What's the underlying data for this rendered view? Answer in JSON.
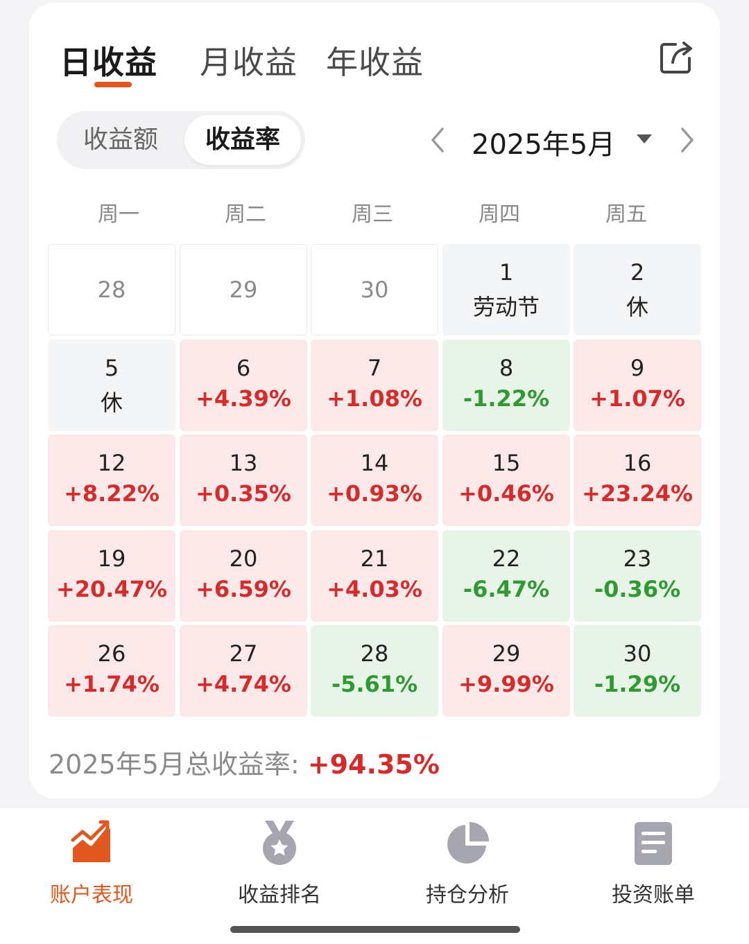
{
  "tabs": [
    {
      "label": "日收益",
      "active": true
    },
    {
      "label": "月收益",
      "active": false
    },
    {
      "label": "年收益",
      "active": false
    }
  ],
  "toggle": {
    "options": [
      "收益额",
      "收益率"
    ],
    "selected": "收益率"
  },
  "month": {
    "label": "2025年5月"
  },
  "weekdays": [
    "周一",
    "周二",
    "周三",
    "周四",
    "周五"
  ],
  "calendar": [
    [
      {
        "day": "28",
        "type": "empty"
      },
      {
        "day": "29",
        "type": "empty"
      },
      {
        "day": "30",
        "type": "empty"
      },
      {
        "day": "1",
        "type": "holiday",
        "text": "劳动节"
      },
      {
        "day": "2",
        "type": "holiday",
        "text": "休"
      }
    ],
    [
      {
        "day": "5",
        "type": "holiday",
        "text": "休"
      },
      {
        "day": "6",
        "type": "up",
        "text": "+4.39%"
      },
      {
        "day": "7",
        "type": "up",
        "text": "+1.08%"
      },
      {
        "day": "8",
        "type": "down",
        "text": "-1.22%"
      },
      {
        "day": "9",
        "type": "up",
        "text": "+1.07%"
      }
    ],
    [
      {
        "day": "12",
        "type": "up",
        "text": "+8.22%"
      },
      {
        "day": "13",
        "type": "up",
        "text": "+0.35%"
      },
      {
        "day": "14",
        "type": "up",
        "text": "+0.93%"
      },
      {
        "day": "15",
        "type": "up",
        "text": "+0.46%"
      },
      {
        "day": "16",
        "type": "up",
        "text": "+23.24%"
      }
    ],
    [
      {
        "day": "19",
        "type": "up",
        "text": "+20.47%"
      },
      {
        "day": "20",
        "type": "up",
        "text": "+6.59%"
      },
      {
        "day": "21",
        "type": "up",
        "text": "+4.03%"
      },
      {
        "day": "22",
        "type": "down",
        "text": "-6.47%"
      },
      {
        "day": "23",
        "type": "down",
        "text": "-0.36%"
      }
    ],
    [
      {
        "day": "26",
        "type": "up",
        "text": "+1.74%"
      },
      {
        "day": "27",
        "type": "up",
        "text": "+4.74%"
      },
      {
        "day": "28",
        "type": "down",
        "text": "-5.61%"
      },
      {
        "day": "29",
        "type": "up",
        "text": "+9.99%"
      },
      {
        "day": "30",
        "type": "down",
        "text": "-1.29%"
      }
    ]
  ],
  "summary": {
    "label": "2025年5月总收益率:",
    "value": "+94.35%"
  },
  "bottom_nav": [
    {
      "label": "账户表现",
      "icon": "trend-chart-icon",
      "active": true
    },
    {
      "label": "收益排名",
      "icon": "medal-icon",
      "active": false
    },
    {
      "label": "持仓分析",
      "icon": "pie-chart-icon",
      "active": false
    },
    {
      "label": "投资账单",
      "icon": "bill-icon",
      "active": false
    }
  ],
  "colors": {
    "accent": "#e0581f",
    "up": "#d62b2b",
    "down": "#2f9a32"
  }
}
